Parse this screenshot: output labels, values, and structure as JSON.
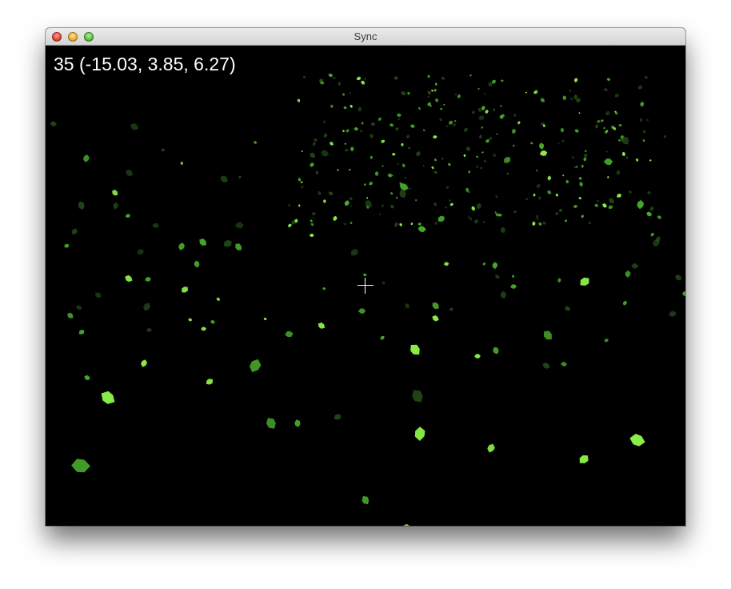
{
  "window": {
    "title": "Sync"
  },
  "hud": {
    "text": "35 (-15.03, 3.85, 6.27)"
  },
  "colors": {
    "background": "#000000",
    "cube_bright": "#8cf04a",
    "cube_mid": "#4fb830",
    "cube_dark": "#2b5a1e",
    "hud_text": "#ffffff"
  }
}
